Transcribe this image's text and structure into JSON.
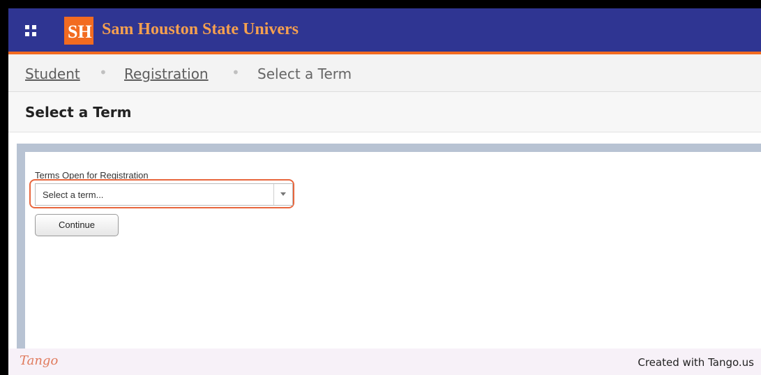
{
  "header": {
    "grid_icon": "apps-grid-icon",
    "logo_letters": "SH",
    "university_name": "Sam Houston State Univers"
  },
  "breadcrumb": {
    "items": [
      "Student",
      "Registration",
      "Select a Term"
    ],
    "separator": "•"
  },
  "page": {
    "title": "Select a Term"
  },
  "form": {
    "term_label": "Terms Open for Registration",
    "term_select_value": "Select a term...",
    "continue_label": "Continue"
  },
  "footer": {
    "brand": "Tango",
    "credit": "Created with Tango.us"
  },
  "colors": {
    "header_bg": "#2f3592",
    "accent_orange": "#f26b21",
    "highlight": "#e8663d"
  }
}
